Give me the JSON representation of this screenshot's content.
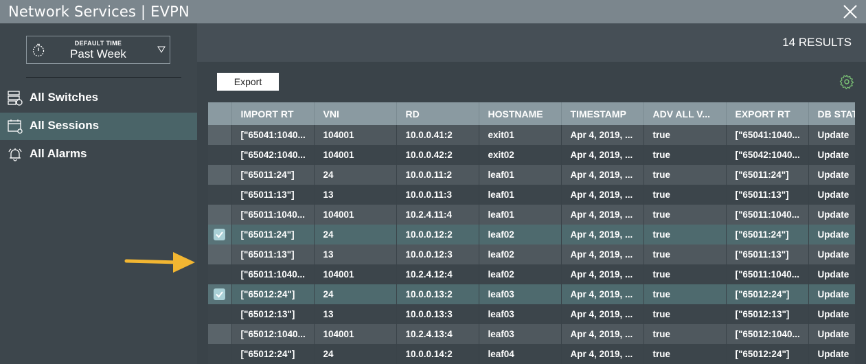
{
  "window": {
    "title": "Network Services | EVPN"
  },
  "sidebar": {
    "time_picker": {
      "label": "DEFAULT TIME",
      "value": "Past Week"
    },
    "items": [
      {
        "label": "All Switches",
        "icon": "switches-icon",
        "active": false
      },
      {
        "label": "All Sessions",
        "icon": "sessions-icon",
        "active": true
      },
      {
        "label": "All Alarms",
        "icon": "alarm-bell-icon",
        "active": false
      }
    ]
  },
  "main": {
    "results": "14 RESULTS",
    "export_label": "Export"
  },
  "table": {
    "columns": [
      "IMPORT RT",
      "VNI",
      "RD",
      "HOSTNAME",
      "TIMESTAMP",
      "ADV ALL V...",
      "EXPORT RT",
      "DB STATE"
    ],
    "rows": [
      {
        "checked": false,
        "cells": [
          "[\"65041:1040...",
          "104001",
          "10.0.0.41:2",
          "exit01",
          "Apr 4, 2019, ...",
          "true",
          "[\"65041:1040...",
          "Update"
        ]
      },
      {
        "checked": false,
        "cells": [
          "[\"65042:1040...",
          "104001",
          "10.0.0.42:2",
          "exit02",
          "Apr 4, 2019, ...",
          "true",
          "[\"65042:1040...",
          "Update"
        ]
      },
      {
        "checked": false,
        "cells": [
          "[\"65011:24\"]",
          "24",
          "10.0.0.11:2",
          "leaf01",
          "Apr 4, 2019, ...",
          "true",
          "[\"65011:24\"]",
          "Update"
        ]
      },
      {
        "checked": false,
        "cells": [
          "[\"65011:13\"]",
          "13",
          "10.0.0.11:3",
          "leaf01",
          "Apr 4, 2019, ...",
          "true",
          "[\"65011:13\"]",
          "Update"
        ]
      },
      {
        "checked": false,
        "cells": [
          "[\"65011:1040...",
          "104001",
          "10.2.4.11:4",
          "leaf01",
          "Apr 4, 2019, ...",
          "true",
          "[\"65011:1040...",
          "Update"
        ]
      },
      {
        "checked": true,
        "cells": [
          "[\"65011:24\"]",
          "24",
          "10.0.0.12:2",
          "leaf02",
          "Apr 4, 2019, ...",
          "true",
          "[\"65011:24\"]",
          "Update"
        ]
      },
      {
        "checked": false,
        "cells": [
          "[\"65011:13\"]",
          "13",
          "10.0.0.12:3",
          "leaf02",
          "Apr 4, 2019, ...",
          "true",
          "[\"65011:13\"]",
          "Update"
        ]
      },
      {
        "checked": false,
        "cells": [
          "[\"65011:1040...",
          "104001",
          "10.2.4.12:4",
          "leaf02",
          "Apr 4, 2019, ...",
          "true",
          "[\"65011:1040...",
          "Update"
        ]
      },
      {
        "checked": true,
        "cells": [
          "[\"65012:24\"]",
          "24",
          "10.0.0.13:2",
          "leaf03",
          "Apr 4, 2019, ...",
          "true",
          "[\"65012:24\"]",
          "Update"
        ]
      },
      {
        "checked": false,
        "cells": [
          "[\"65012:13\"]",
          "13",
          "10.0.0.13:3",
          "leaf03",
          "Apr 4, 2019, ...",
          "true",
          "[\"65012:13\"]",
          "Update"
        ]
      },
      {
        "checked": false,
        "cells": [
          "[\"65012:1040...",
          "104001",
          "10.2.4.13:4",
          "leaf03",
          "Apr 4, 2019, ...",
          "true",
          "[\"65012:1040...",
          "Update"
        ]
      },
      {
        "checked": false,
        "cells": [
          "[\"65012:24\"]",
          "24",
          "10.0.0.14:2",
          "leaf04",
          "Apr 4, 2019, ...",
          "true",
          "[\"65012:24\"]",
          "Update"
        ]
      }
    ]
  },
  "colors": {
    "title_bar": "#7b868d",
    "sidebar": "#3d464c",
    "active_nav": "#4a6468",
    "table_header": "#8a9aa1",
    "checkbox": "#a9d0d6",
    "gear_accent": "#7cc576",
    "arrow": "#f2b632"
  }
}
